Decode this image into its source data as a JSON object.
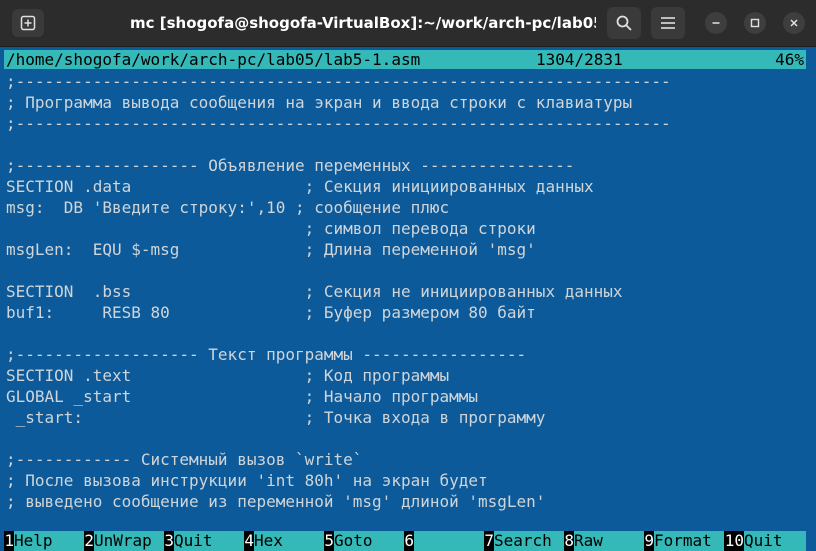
{
  "window": {
    "title": "mc [shogofa@shogofa-VirtualBox]:~/work/arch-pc/lab05",
    "icons": {
      "new_tab": "new-tab-icon",
      "search": "search-icon",
      "menu": "hamburger-menu-icon",
      "minimize": "minimize-icon",
      "maximize": "maximize-icon",
      "close": "close-icon"
    }
  },
  "editor": {
    "path": "/home/shogofa/work/arch-pc/lab05/lab5-1.asm",
    "position": "1304/2831",
    "percent": "46%",
    "lines": [
      ";--------------------------------------------------------------------",
      "; Программа вывода сообщения на экран и ввода строки с клавиатуры",
      ";--------------------------------------------------------------------",
      "",
      ";------------------- Объявление переменных ----------------",
      "SECTION .data                  ; Секция инициированных данных",
      "msg:  DB 'Введите строку:',10 ; сообщение плюс",
      "                               ; символ перевода строки",
      "msgLen:  EQU $-msg             ; Длина переменной 'msg'",
      "",
      "SECTION  .bss                  ; Секция не инициированных данных",
      "buf1:     RESB 80              ; Буфер размером 80 байт",
      "",
      ";------------------- Текст программы -----------------",
      "SECTION .text                  ; Код программы",
      "GLOBAL _start                  ; Начало программы",
      " _start:                       ; Точка входа в программу",
      "",
      ";------------ Системный вызов `write`",
      "; После вызова инструкции 'int 80h' на экран будет",
      "; выведено сообщение из переменной 'msg' длиной 'msgLen'",
      ""
    ]
  },
  "fkeys": [
    {
      "num": "1",
      "label": "Help"
    },
    {
      "num": "2",
      "label": "UnWrap"
    },
    {
      "num": "3",
      "label": "Quit"
    },
    {
      "num": "4",
      "label": "Hex"
    },
    {
      "num": "5",
      "label": "Goto"
    },
    {
      "num": "6",
      "label": ""
    },
    {
      "num": "7",
      "label": "Search"
    },
    {
      "num": "8",
      "label": "Raw"
    },
    {
      "num": "9",
      "label": "Format"
    },
    {
      "num": "10",
      "label": "Quit"
    }
  ],
  "colors": {
    "terminal_bg": "#0d5a9b",
    "text": "#cfd5d8",
    "accent_cyan": "#35b8b8",
    "titlebar": "#2c2c2c"
  }
}
